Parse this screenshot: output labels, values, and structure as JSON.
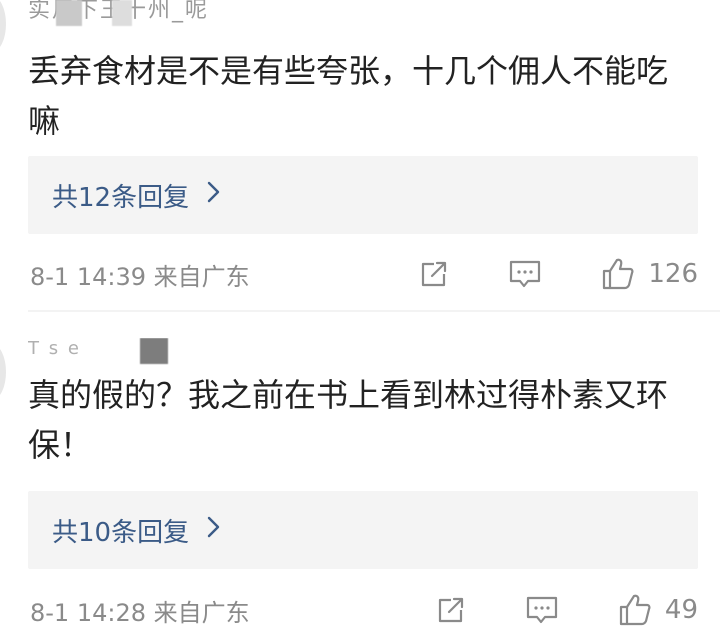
{
  "comments": [
    {
      "username": "实用下王十州_呢",
      "content": "丢弃食材是不是有些夸张，十几个佣人不能吃嘛",
      "replies_label": "共12条回复",
      "time": "8-1 14:39 来自广东",
      "likes": "126"
    },
    {
      "username": "T          s e",
      "content": "真的假的？我之前在书上看到林过得朴素又环保！",
      "replies_label": "共10条回复",
      "time": "8-1 14:28 来自广东",
      "likes": "49"
    }
  ],
  "icons": {
    "chevron": "chevron-right-icon",
    "share": "share-icon",
    "comment": "comment-icon",
    "like": "thumbs-up-icon"
  },
  "colors": {
    "link": "#3b5b87",
    "meta": "#8a8a8a",
    "reply_bg": "#f4f4f4"
  }
}
